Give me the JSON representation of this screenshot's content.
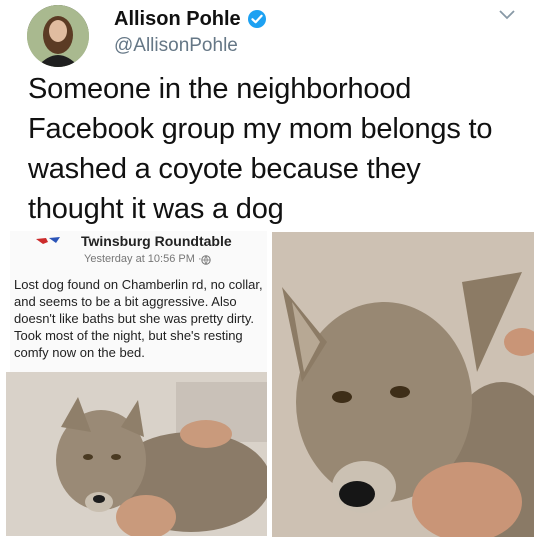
{
  "tweet": {
    "author_name": "Allison Pohle",
    "handle": "@AllisonPohle",
    "text": "Someone in the neighborhood Facebook group my mom belongs to washed a coyote because they thought it was a dog",
    "accent_color": "#1da1f2"
  },
  "embedded_post": {
    "group_name": "Twinsburg Roundtable",
    "timestamp": "Yesterday at 10:56 PM · ",
    "body": "Lost dog found on Chamberlin rd, no collar, and seems to be a bit aggressive. Also doesn't like baths but she was pretty dirty. Took most of the night, but she's resting comfy now on the bed.",
    "privacy_icon": "globe-icon"
  },
  "icons": {
    "verified": "verified-badge-icon",
    "menu": "chevron-down-icon"
  }
}
